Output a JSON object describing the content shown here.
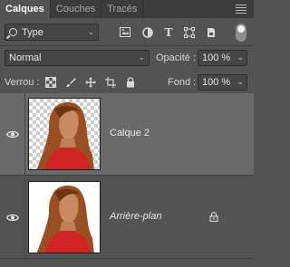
{
  "tabs": [
    {
      "label": "Calques",
      "active": true
    },
    {
      "label": "Couches",
      "active": false
    },
    {
      "label": "Tracés",
      "active": false
    }
  ],
  "filter": {
    "value": "Type",
    "icon": "search-icon"
  },
  "filter_icons": [
    "pixel-filter-icon",
    "adjustment-filter-icon",
    "type-filter-icon",
    "shape-filter-icon",
    "smart-object-filter-icon"
  ],
  "blend": {
    "value": "Normal"
  },
  "opacity": {
    "label": "Opacité :",
    "value": "100 %"
  },
  "lock": {
    "label": "Verrou :"
  },
  "fill": {
    "label": "Fond :",
    "value": "100 %"
  },
  "layers": [
    {
      "name": "Calque 2",
      "selected": true,
      "visible": true,
      "transparent": true,
      "locked": false
    },
    {
      "name": "Arrière-plan",
      "selected": false,
      "visible": true,
      "transparent": false,
      "locked": true
    }
  ],
  "colors": {
    "panel_bg": "#535353",
    "selected_row": "#6a6a6a",
    "tab_bar": "#3c3c3c"
  }
}
